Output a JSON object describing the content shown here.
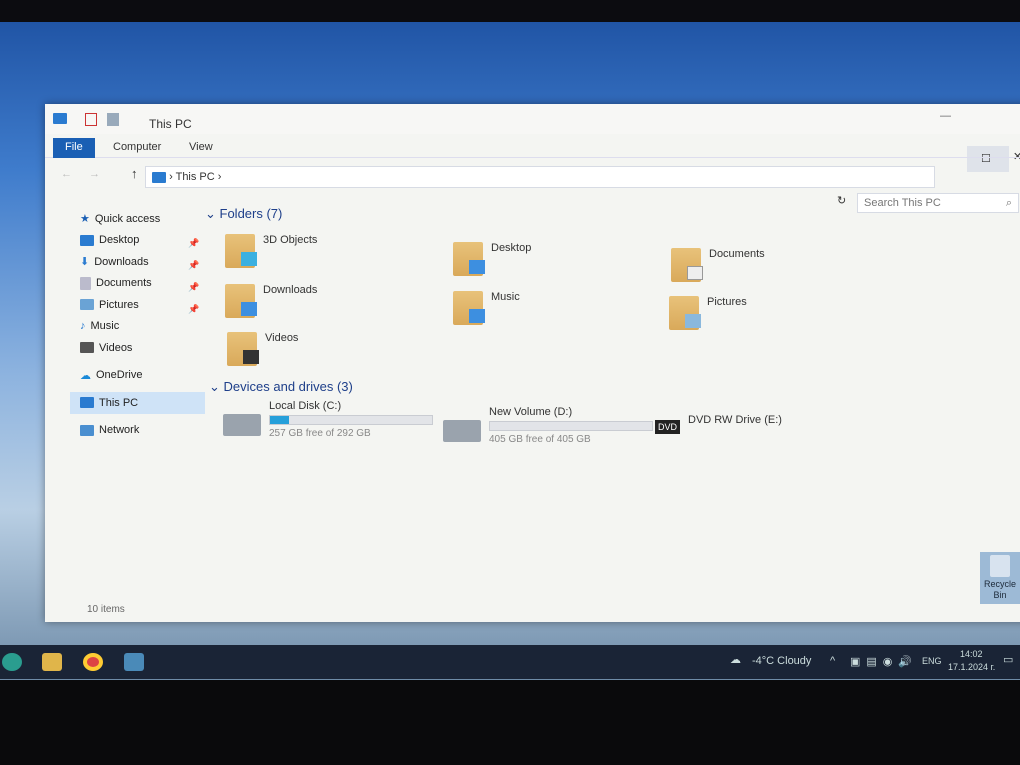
{
  "window": {
    "title": "This PC",
    "minimize": "—",
    "maximize": "☐",
    "close": "✕"
  },
  "ribbon": {
    "tabs": [
      "File",
      "Computer",
      "View"
    ]
  },
  "address": {
    "back": "←",
    "forward": "→",
    "up": "↑",
    "path": "This PC",
    "sep": "›",
    "search_placeholder": "Search This PC",
    "refresh": "↻"
  },
  "sidebar": {
    "items": [
      {
        "label": "Quick access",
        "icon": "star-icon",
        "color": "#1a5fb4"
      },
      {
        "label": "Desktop",
        "icon": "desktop-icon",
        "color": "#2a7bd0",
        "pinned": true
      },
      {
        "label": "Downloads",
        "icon": "download-icon",
        "color": "#2a7bd0",
        "pinned": true
      },
      {
        "label": "Documents",
        "icon": "document-icon",
        "color": "#9aa",
        "pinned": true
      },
      {
        "label": "Pictures",
        "icon": "picture-icon",
        "color": "#5a9bd0",
        "pinned": true
      },
      {
        "label": "Music",
        "icon": "music-icon",
        "color": "#2a7bd0"
      },
      {
        "label": "Videos",
        "icon": "video-icon",
        "color": "#555"
      },
      {
        "label": "OneDrive",
        "icon": "cloud-icon",
        "color": "#1a8ad8"
      },
      {
        "label": "This PC",
        "icon": "computer-icon",
        "color": "#2a7bd0",
        "selected": true
      },
      {
        "label": "Network",
        "icon": "network-icon",
        "color": "#2a7bd0"
      }
    ]
  },
  "folders": {
    "header": "Folders (7)",
    "items": [
      "3D Objects",
      "Desktop",
      "Documents",
      "Downloads",
      "Music",
      "Pictures",
      "Videos"
    ]
  },
  "drives": {
    "header": "Devices and drives (3)",
    "items": [
      {
        "name": "Local Disk (C:)",
        "free": "257 GB free of 292 GB",
        "used_fraction": 0.12
      },
      {
        "name": "New Volume (D:)",
        "free": "405 GB free of 405 GB",
        "used_fraction": 0.0
      },
      {
        "name": "DVD RW Drive (E:)",
        "badge": "DVD"
      }
    ]
  },
  "status": {
    "items": "10 items"
  },
  "desktop": {
    "recycle_bin": "Recycle Bin"
  },
  "taskbar": {
    "weather": "-4°C  Cloudy",
    "tray": "^",
    "lang": "ENG",
    "time": "14:02",
    "date": "17.1.2024 г."
  }
}
